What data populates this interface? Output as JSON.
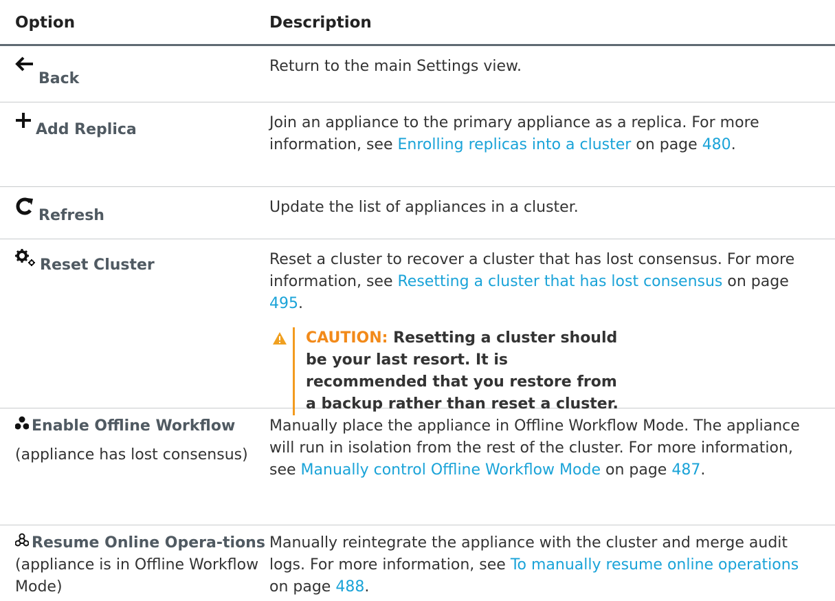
{
  "table": {
    "header": {
      "option": "Option",
      "description": "Description"
    },
    "rows": [
      {
        "name": "Back",
        "icon": "back-arrow-icon",
        "desc": "Return to the main Settings view."
      },
      {
        "name": "Add Replica",
        "icon": "plus-icon",
        "desc_pre": "Join an appliance to the primary appliance as a replica. For more information, see ",
        "link": "Enrolling replicas into a cluster",
        "desc_mid": " on page ",
        "page": "480",
        "desc_post": "."
      },
      {
        "name": "Refresh",
        "icon": "refresh-icon",
        "desc": "Update the list of appliances in a cluster."
      },
      {
        "name": "Reset Cluster",
        "icon": "gears-icon",
        "desc_pre": "Reset a cluster to recover a cluster that has lost consensus. For more information, see ",
        "link": "Resetting a cluster that has lost consensus",
        "desc_mid": " on page ",
        "page": "495",
        "desc_post": ".",
        "caution_label": "CAUTION:",
        "caution_text": " Resetting a cluster should be your last resort. It is recommended that you restore from a backup rather than reset a cluster."
      },
      {
        "name": "Enable Offline Workflow",
        "icon": "network-nodes-icon",
        "sub": "(appliance has lost consensus)",
        "desc_pre": "Manually place the appliance in Offline Workflow Mode. The appliance will run in isolation from the rest of the cluster. For more information, see ",
        "link": "Manually control Offline Workflow Mode",
        "desc_mid": " on page ",
        "page": "487",
        "desc_post": "."
      },
      {
        "name": "Resume Online Opera-tions",
        "icon": "network-nodes-outline-icon",
        "sub": " (appliance is in Offline Workflow Mode)",
        "desc_pre": "Manually reintegrate the appliance with the cluster and merge audit logs. For more information, see ",
        "link": "To manually resume online operations",
        "desc_mid": " on page ",
        "page": "488",
        "desc_post": "."
      }
    ]
  }
}
